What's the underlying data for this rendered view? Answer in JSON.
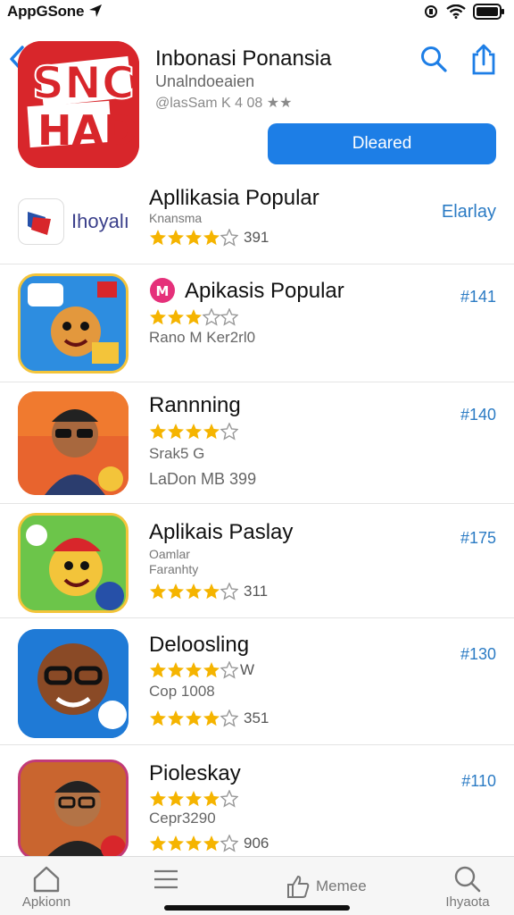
{
  "status_bar": {
    "carrier": "AppGSone"
  },
  "header": {
    "icon_text": "SNC",
    "icon_text_2": "HAD",
    "title": "Inbonasi Ponansia",
    "subtitle": "Unalndoeaien",
    "meta": "@lasSam K 4 08 ★★",
    "get_label": "Dleared"
  },
  "list": [
    {
      "title": "Apllikasia Popular",
      "sub": "Knansma",
      "rating_count": "391",
      "rating": 4,
      "rank": "Elarlay",
      "logo_text": "Ihoyalı"
    },
    {
      "title": "Apikasis Popular",
      "rating": 3,
      "extra": "Rano M Ker2rl0",
      "rank": "#141",
      "badge": "M"
    },
    {
      "title": "Rannning",
      "rating": 4,
      "sub": "Srak5 G",
      "extra": "LaDon MB 399",
      "rank": "#140"
    },
    {
      "title": "Aplikais Paslay",
      "sub": "Oamlar",
      "sub2": "Faranhty",
      "rating_count": "311",
      "rating": 4,
      "rank": "#175"
    },
    {
      "title": "Deloosling",
      "rating": 4,
      "rating_suffix": "W",
      "sub": "Cop 1008",
      "rating2": 4,
      "rating2_count": "351",
      "rank": "#130"
    },
    {
      "title": "Pioleskay",
      "rating": 4,
      "sub": "Cepr3290",
      "rating2": 4,
      "rating2_count": "906",
      "rank": "#110"
    }
  ],
  "tabs": [
    "Apkionn",
    "",
    "Memee",
    "Ihyaota"
  ],
  "colors": {
    "accent": "#1d7ee6",
    "rank": "#2b7bc4",
    "star": "#f5b400",
    "hero": "#d8262b"
  }
}
